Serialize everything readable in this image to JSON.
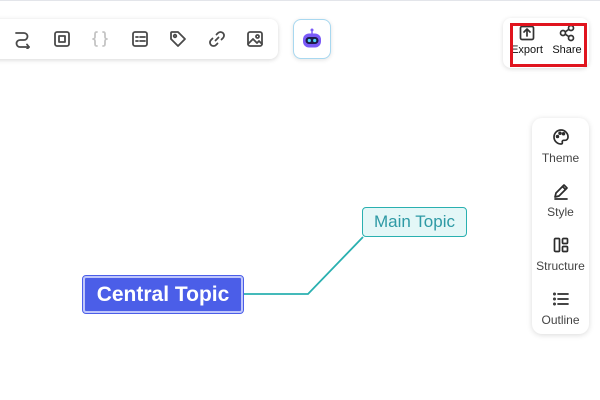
{
  "toolbar": {
    "items": [
      {
        "name": "relationship-button",
        "icon": "curved-arrow-icon"
      },
      {
        "name": "boundary-button",
        "icon": "boundary-icon"
      },
      {
        "name": "summary-button",
        "icon": "curly-braces-icon",
        "disabled": true
      },
      {
        "name": "note-button",
        "icon": "note-icon"
      },
      {
        "name": "tag-button",
        "icon": "tag-icon"
      },
      {
        "name": "link-button",
        "icon": "link-icon"
      },
      {
        "name": "image-button",
        "icon": "image-icon"
      }
    ],
    "ai_button": {
      "icon": "ai-robot-icon"
    }
  },
  "share_panel": {
    "export_label": "Export",
    "share_label": "Share",
    "highlight_color": "#e0141e"
  },
  "side_panel": {
    "theme_label": "Theme",
    "style_label": "Style",
    "structure_label": "Structure",
    "outline_label": "Outline"
  },
  "canvas": {
    "central_topic": "Central Topic",
    "main_topic": "Main Topic",
    "central_color": "#4b5ee8",
    "branch_color": "#2ab0b0"
  }
}
